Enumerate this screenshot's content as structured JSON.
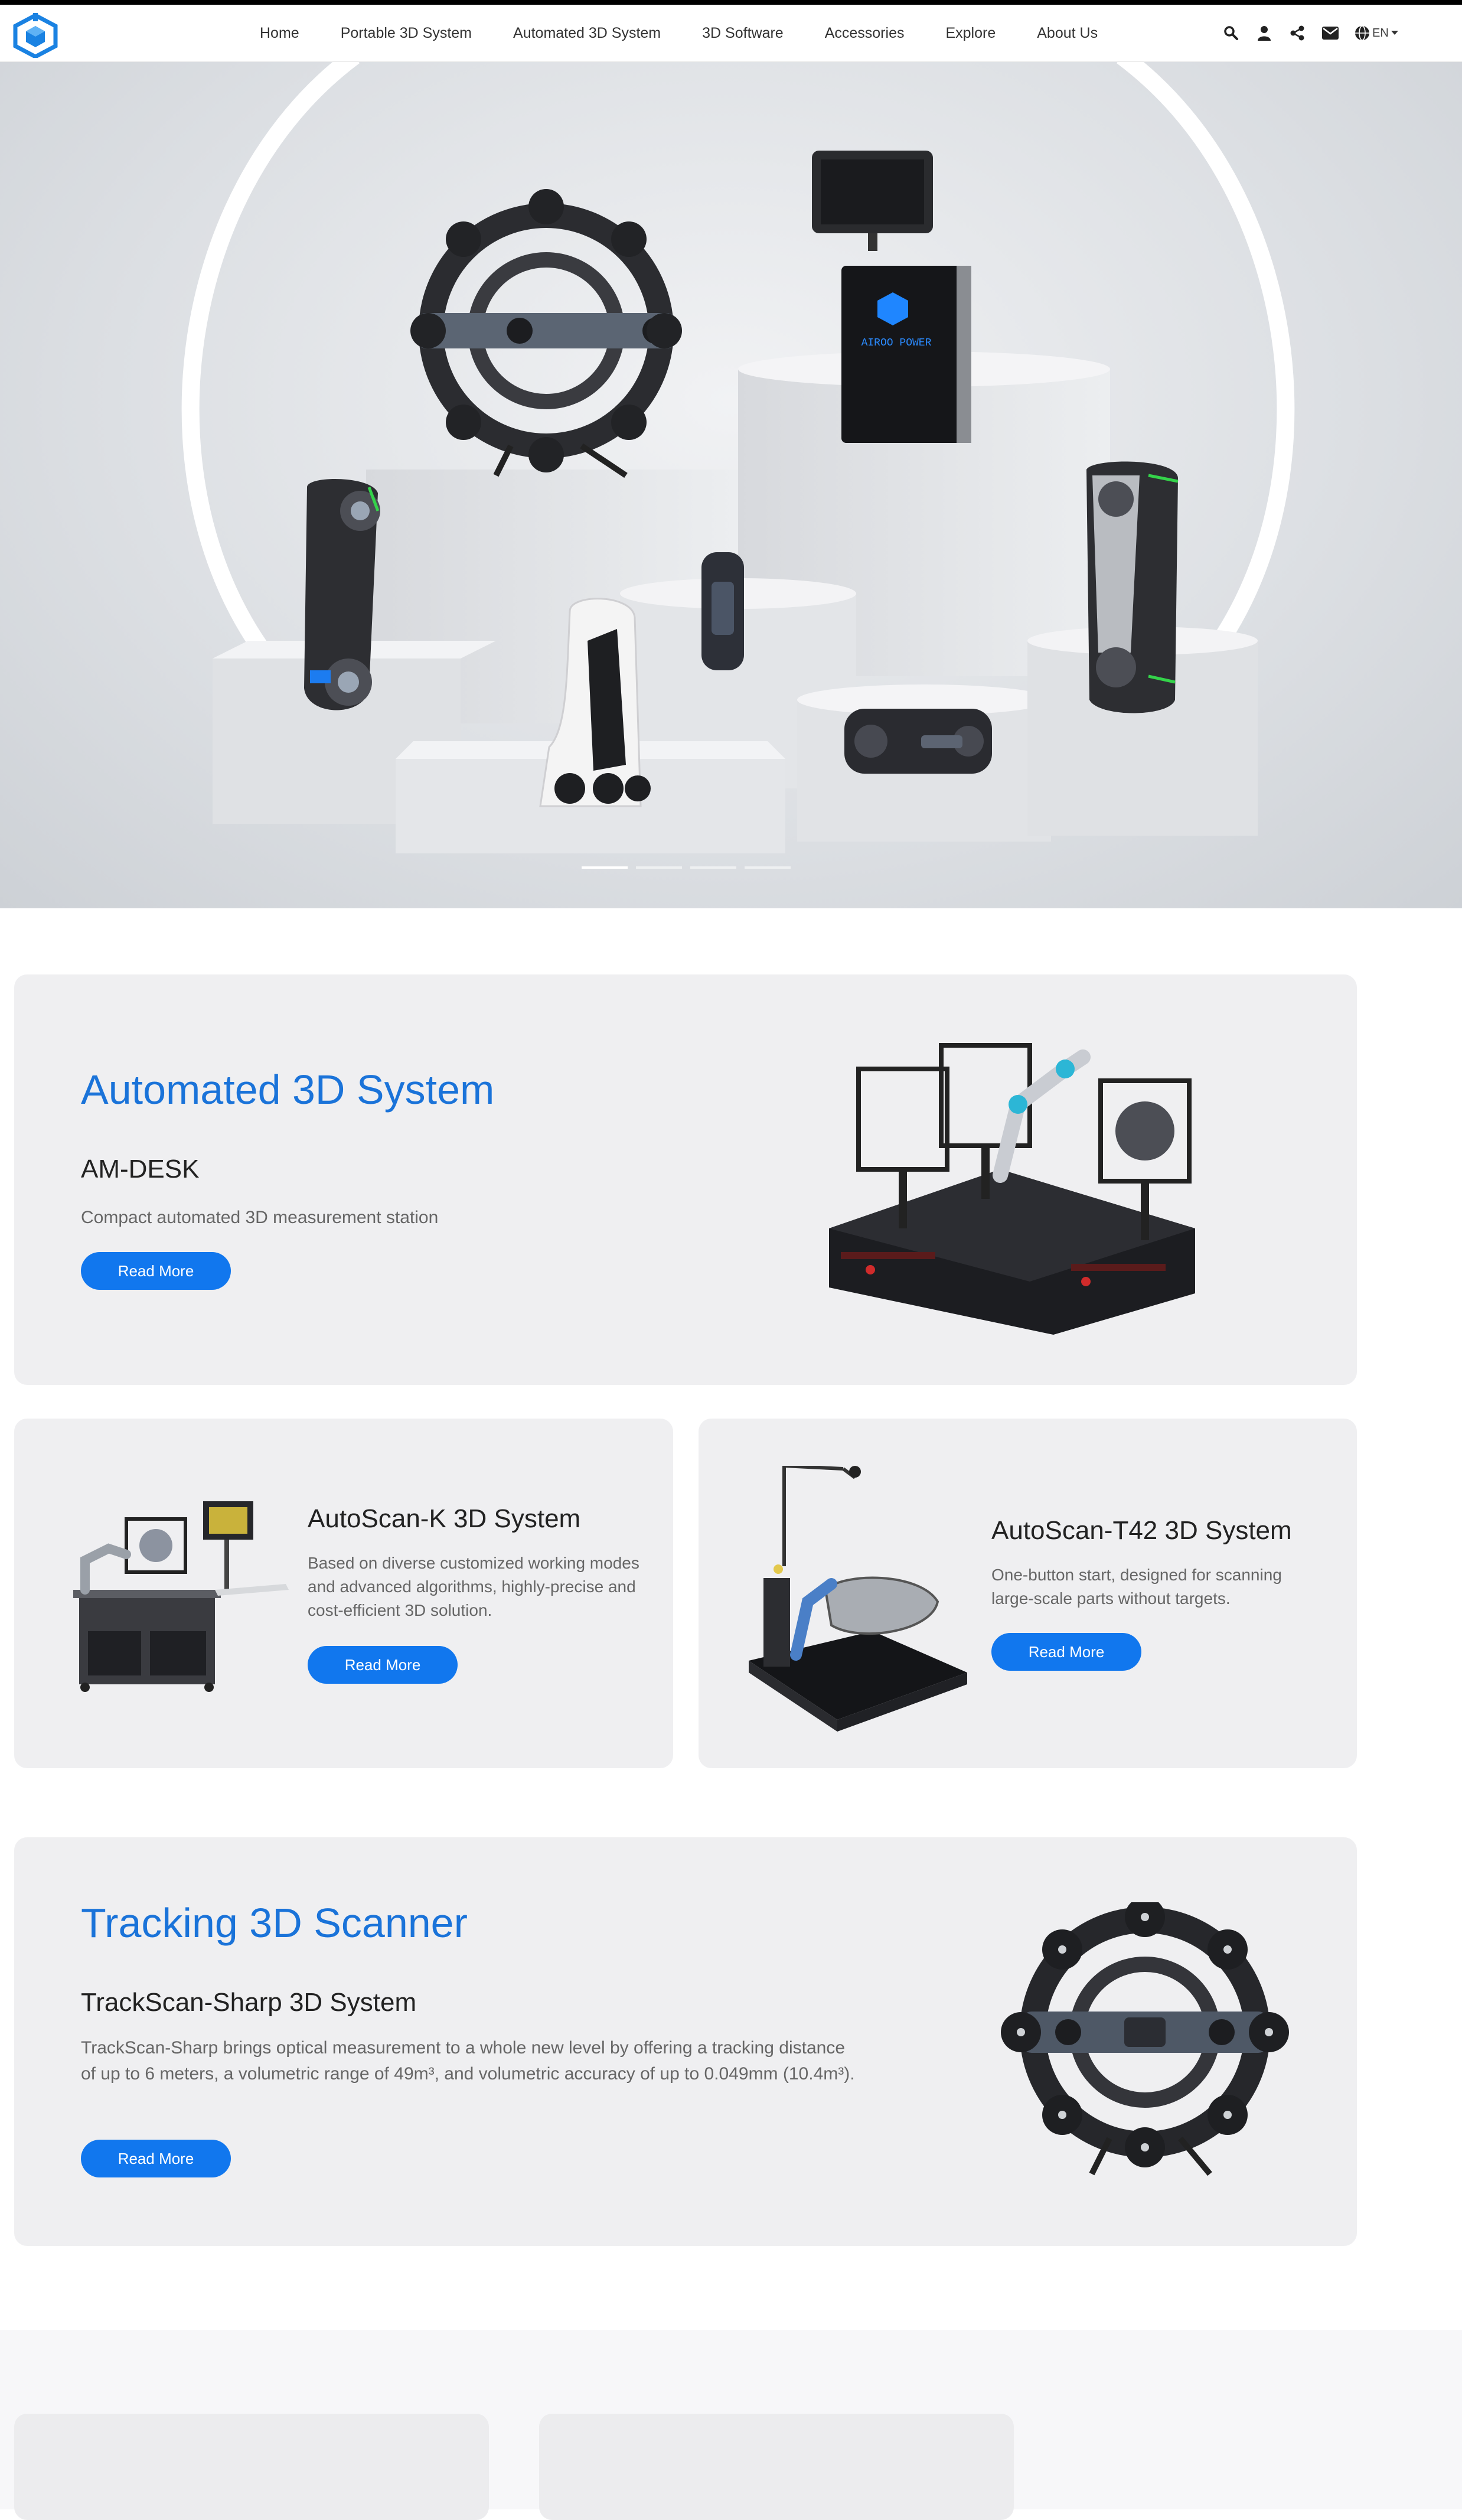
{
  "nav": {
    "items": [
      {
        "label": "Home"
      },
      {
        "label": "Portable 3D System"
      },
      {
        "label": "Automated 3D System"
      },
      {
        "label": "3D Software"
      },
      {
        "label": "Accessories"
      },
      {
        "label": "Explore"
      },
      {
        "label": "About Us"
      }
    ],
    "icons": [
      "search-icon",
      "user-icon",
      "share-icon",
      "mail-icon",
      "globe-icon"
    ],
    "lang": "EN"
  },
  "hero": {
    "screen_text": "AIROO POWER",
    "slides": 4,
    "active_slide": 1
  },
  "automated": {
    "section_title": "Automated 3D System",
    "product": "AM-DESK",
    "desc": "Compact automated 3D measurement station",
    "button": "Read More"
  },
  "autoscan_k": {
    "product": "AutoScan-K 3D System",
    "desc": "Based on diverse customized working modes and advanced algorithms, highly-precise and cost-efficient 3D solution.",
    "button": "Read More"
  },
  "autoscan_t42": {
    "product": "AutoScan-T42 3D System",
    "desc": "One-button start, designed for scanning large-scale parts without targets.",
    "button": "Read More"
  },
  "tracking": {
    "section_title": "Tracking 3D Scanner",
    "product": "TrackScan-Sharp 3D System",
    "desc": "TrackScan-Sharp brings optical measurement to a whole new level by offering a tracking distance of up to 6 meters, a volumetric range of 49m³, and volumetric accuracy of up to 0.049mm (10.4m³).",
    "button": "Read More"
  },
  "colors": {
    "accent": "#1177ee",
    "title_blue": "#1a73d9",
    "card_bg": "#efeff1"
  }
}
